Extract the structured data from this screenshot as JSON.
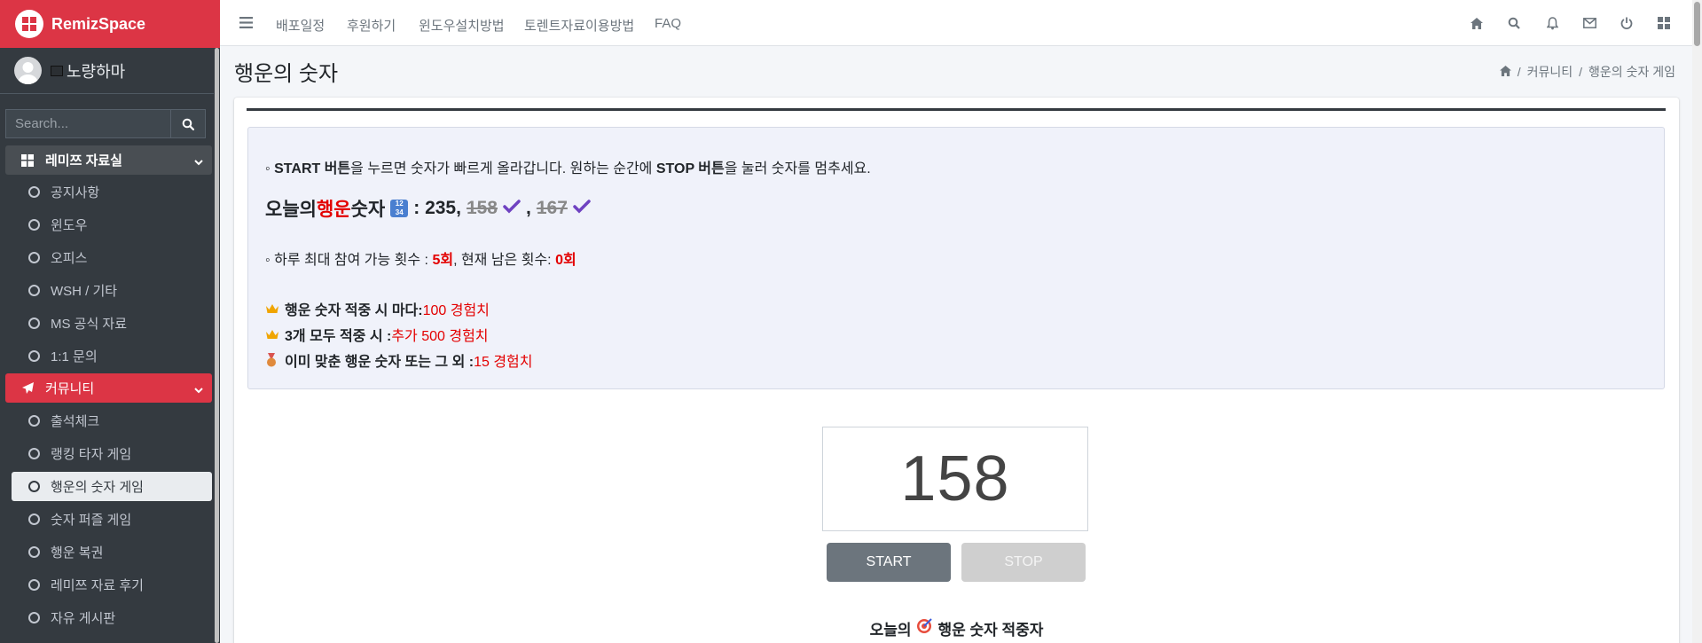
{
  "brand": {
    "name": "RemizSpace"
  },
  "user": {
    "name": "노량하마"
  },
  "search": {
    "placeholder": "Search..."
  },
  "sidebar": {
    "sections": [
      {
        "label": "레미쯔 자료실",
        "icon": "windows-icon"
      },
      {
        "label": "커뮤니티",
        "icon": "paper-plane-icon"
      }
    ],
    "items_a": [
      "공지사항",
      "윈도우",
      "오피스",
      "WSH / 기타",
      "MS 공식 자료",
      "1:1 문의"
    ],
    "items_b": [
      "출석체크",
      "랭킹 타자 게임",
      "행운의 숫자 게임",
      "숫자 퍼즐 게임",
      "행운 복권",
      "레미쯔 자료 후기",
      "자유 게시판"
    ]
  },
  "topnav": {
    "links": [
      "배포일정",
      "후원하기",
      "윈도우설치방법",
      "토렌트자료이용방법",
      "FAQ"
    ]
  },
  "page": {
    "title": "행운의 숫자",
    "breadcrumb": [
      "커뮤니티",
      "행운의 숫자 게임"
    ]
  },
  "info": {
    "line1_prefix": "◦ ",
    "line1_start": "START 버튼",
    "line1_mid": "을 누르면 숫자가 빠르게 올라갑니다. 원하는 순간에 ",
    "line1_stop": "STOP 버튼",
    "line1_end": "을 눌러 숫자를 멈추세요.",
    "lucky_prefix": "오늘의 ",
    "lucky_word": "행운",
    "lucky_suffix": " 숫자",
    "lucky_colon": ": 235,",
    "lucky_num2": "158",
    "lucky_comma": ",",
    "lucky_num3": "167",
    "limit_prefix": "◦ 하루 최대 참여 가능 횟수 : ",
    "limit_max": "5회",
    "limit_mid": ", 현재 남은 횟수: ",
    "limit_left": "0회",
    "reward1_label": "행운 숫자 적중 시 마다: ",
    "reward1_value": "100 경험치",
    "reward2_label": "3개 모두 적중 시 : ",
    "reward2_value": "추가 500 경험치",
    "reward3_label": "이미 맞춘 행운 숫자 또는 그 외 : ",
    "reward3_value": "15 경험치"
  },
  "game": {
    "current_number": "158",
    "start_label": "START",
    "stop_label": "STOP"
  },
  "winners": {
    "prefix": "오늘의",
    "suffix": "행운 숫자 적중자"
  },
  "colors": {
    "brand": "#dc3545",
    "sidebar": "#343a40",
    "highlight": "#e30000",
    "check": "#6f42c1"
  }
}
